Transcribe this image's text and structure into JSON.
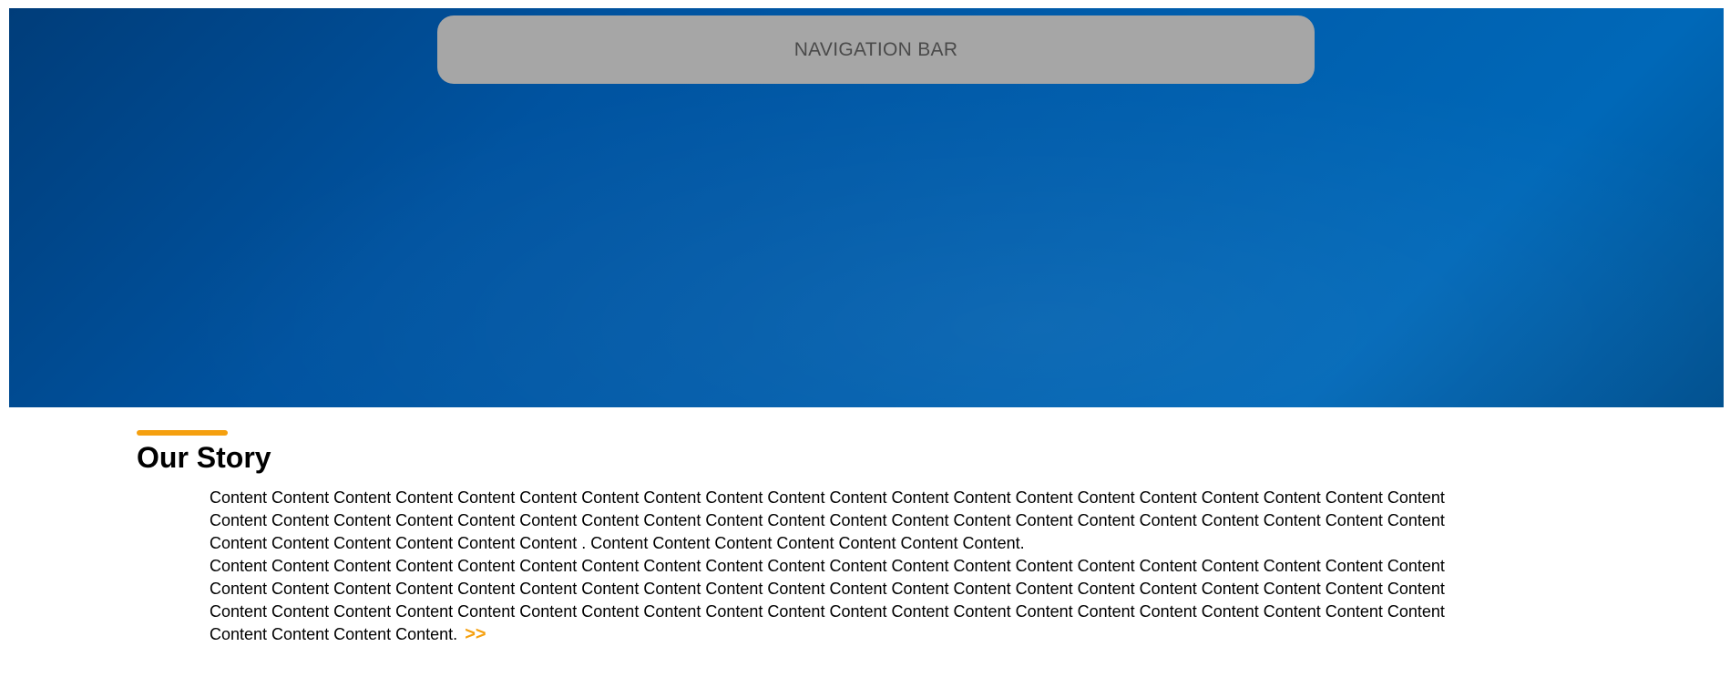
{
  "hero": {
    "nav_bar_label": "NAVIGATION BAR"
  },
  "story": {
    "title": "Our Story",
    "paragraph_1": "Content Content Content Content Content Content Content Content Content Content Content Content Content Content Content Content Content Content Content Content Content Content Content Content Content Content Content Content Content Content Content Content Content Content Content Content Content Content Content Content Content Content Content Content Content Content . Content Content Content Content Content Content Content.",
    "paragraph_2": "Content Content Content Content Content Content Content Content Content Content Content Content Content Content Content Content Content Content Content Content Content Content Content Content Content Content Content Content Content Content Content Content Content Content Content Content Content Content Content Content Content Content Content Content Content Content Content Content Content Content Content Content Content Content Content Content Content Content Content Content Content Content Content Content.",
    "read_more_label": ">>"
  },
  "colors": {
    "accent": "#f5a00f",
    "hero_blue": "#0058a8",
    "nav_bar_gray": "#a6a6a6"
  }
}
